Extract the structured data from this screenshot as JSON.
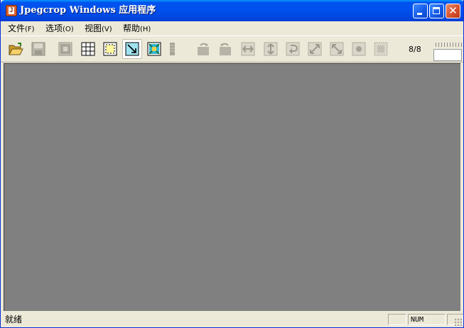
{
  "window": {
    "title": "Jpegcrop Windows 应用程序"
  },
  "menu": [
    {
      "label": "文件",
      "hotkey": "(F)"
    },
    {
      "label": "选项",
      "hotkey": "(O)"
    },
    {
      "label": "视图",
      "hotkey": "(V)"
    },
    {
      "label": "帮助",
      "hotkey": "(H)"
    }
  ],
  "toolbar": {
    "tools": [
      {
        "icon": "open-folder-icon",
        "enabled": true
      },
      {
        "icon": "save-disk-icon",
        "enabled": false
      },
      {
        "icon": "copy-selection-icon",
        "enabled": false
      },
      {
        "icon": "grid-icon",
        "enabled": true
      },
      {
        "icon": "selection-frame-icon",
        "enabled": true
      },
      {
        "icon": "zoom-fit-icon",
        "enabled": true,
        "pressed": true
      },
      {
        "icon": "crop-icon",
        "enabled": true
      },
      {
        "icon": "bar-icon",
        "enabled": false
      },
      {
        "icon": "rotate-left-icon",
        "enabled": false
      },
      {
        "icon": "rotate-right-icon",
        "enabled": false
      },
      {
        "icon": "flip-horizontal-icon",
        "enabled": false
      },
      {
        "icon": "flip-vertical-icon",
        "enabled": false
      },
      {
        "icon": "rotate-icon",
        "enabled": false
      },
      {
        "icon": "transpose-icon",
        "enabled": false
      },
      {
        "icon": "transverse-icon",
        "enabled": false
      },
      {
        "icon": "center-icon",
        "enabled": false
      },
      {
        "icon": "trim-icon",
        "enabled": false
      }
    ],
    "counter": "8/8"
  },
  "status": {
    "text": "就绪",
    "num": "NUM"
  }
}
